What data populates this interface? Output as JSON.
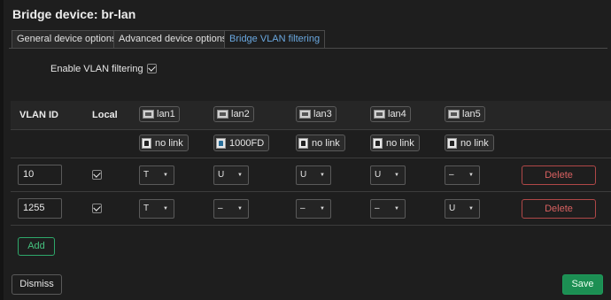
{
  "dialog": {
    "title": "Bridge device: br-lan",
    "tabs": [
      {
        "label": "General device options",
        "active": false
      },
      {
        "label": "Advanced device options",
        "active": false
      },
      {
        "label": "Bridge VLAN filtering",
        "active": true
      }
    ],
    "enable_vlan_filtering": {
      "label": "Enable VLAN filtering",
      "checked": true
    }
  },
  "table": {
    "headers": {
      "vlan_id": "VLAN ID",
      "local": "Local"
    },
    "ports": [
      {
        "name": "lan1",
        "status": "no link"
      },
      {
        "name": "lan2",
        "status": "1000FD"
      },
      {
        "name": "lan3",
        "status": "no link"
      },
      {
        "name": "lan4",
        "status": "no link"
      },
      {
        "name": "lan5",
        "status": "no link"
      }
    ],
    "rows": [
      {
        "vlan_id": "10",
        "local": true,
        "ports": [
          "T",
          "U",
          "U",
          "U",
          "–"
        ],
        "delete_label": "Delete"
      },
      {
        "vlan_id": "1255",
        "local": true,
        "ports": [
          "T",
          "–",
          "–",
          "–",
          "U"
        ],
        "delete_label": "Delete"
      }
    ]
  },
  "buttons": {
    "add": "Add",
    "dismiss": "Dismiss",
    "save": "Save"
  },
  "colors": {
    "accent_tab": "#6aa8e0",
    "delete": "#d86060",
    "add": "#45c07e",
    "save_bg": "#1c8f53"
  }
}
